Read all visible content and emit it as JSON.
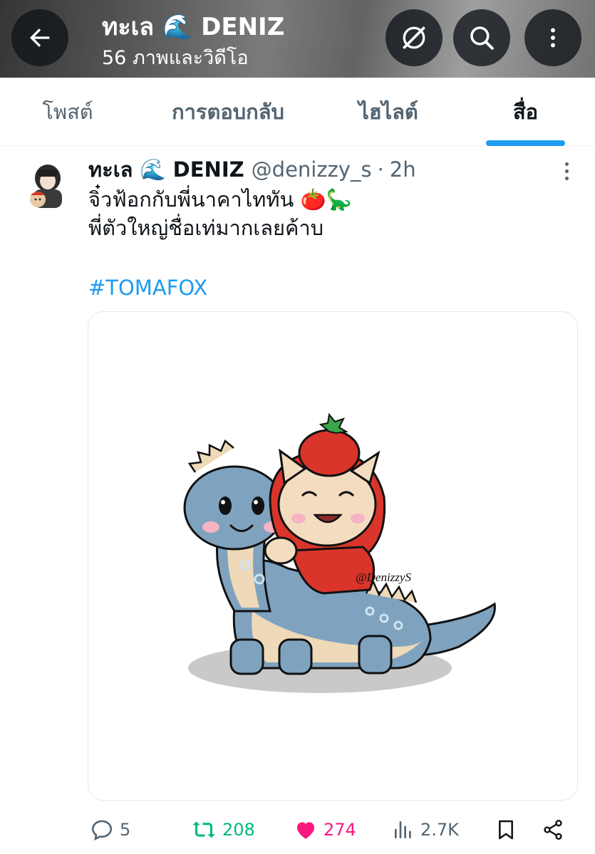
{
  "header": {
    "title": "ทะเล 🌊 DENIZ",
    "subtitle": "56 ภาพและวิดีโอ",
    "buttons": {
      "back": "arrow-left-icon",
      "grok": "grok-icon",
      "search": "search-icon",
      "more": "more-vertical-icon"
    }
  },
  "tabs": [
    {
      "label": "โพสต์",
      "active": false
    },
    {
      "label": "การตอบกลับ",
      "active": false
    },
    {
      "label": "ไฮไลต์",
      "active": false
    },
    {
      "label": "สื่อ",
      "active": true
    }
  ],
  "post": {
    "display_name": "ทะเล 🌊 DENIZ",
    "handle": "@denizzy_s",
    "separator": "·",
    "time": "2h",
    "lines": [
      "จิ๋วฟ้อกกับพี่นาคาไททัน 🍅🦕",
      "พี่ตัวใหญ่ชื่อเท่มากเลยค้าบ"
    ],
    "hashtag": "#TOMAFOX",
    "image_signature": "@DenizzyS",
    "actions": {
      "replies": "5",
      "reposts": "208",
      "likes": "274",
      "views": "2.7K"
    }
  },
  "colors": {
    "accent": "#1d9bf0",
    "repost": "#00ba7c",
    "like": "#f91880",
    "muted": "#536471",
    "text": "#0f1419"
  }
}
